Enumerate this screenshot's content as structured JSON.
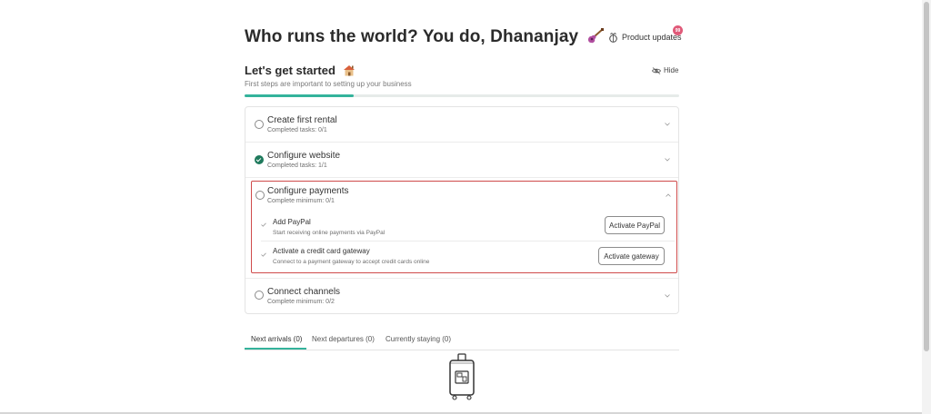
{
  "header": {
    "greeting": "Who runs the world? You do, Dhananjay",
    "greeting_emoji_icon": "guitar-icon",
    "product_updates_label": "Product updates",
    "product_updates_badge": "99"
  },
  "getting_started": {
    "title": "Let's get started",
    "title_emoji_icon": "house-icon",
    "subtitle": "First steps are important to setting up your business",
    "hide_label": "Hide",
    "progress_fraction": 0.25,
    "accent_color": "#34b39b"
  },
  "checklist": {
    "items": [
      {
        "title": "Create first rental",
        "status": "Completed tasks: 0/1",
        "done": false,
        "expanded": false
      },
      {
        "title": "Configure website",
        "status": "Completed tasks: 1/1",
        "done": true,
        "expanded": false
      },
      {
        "title": "Configure payments",
        "status": "Complete minimum: 0/1",
        "done": false,
        "expanded": true,
        "tasks": [
          {
            "title": "Add PayPal",
            "description": "Start receiving online payments via PayPal",
            "button": "Activate PayPal"
          },
          {
            "title": "Activate a credit card gateway",
            "description": "Connect to a payment gateway to accept credit cards online",
            "button": "Activate gateway"
          }
        ]
      },
      {
        "title": "Connect channels",
        "status": "Complete minimum: 0/2",
        "done": false,
        "expanded": false
      }
    ],
    "highlight_color": "#cf4b4b",
    "done_color": "#1f7a5c"
  },
  "tabs": [
    {
      "label": "Next arrivals (0)",
      "active": true
    },
    {
      "label": "Next departures (0)",
      "active": false
    },
    {
      "label": "Currently staying (0)",
      "active": false
    }
  ],
  "empty_state_icon": "suitcase-icon"
}
